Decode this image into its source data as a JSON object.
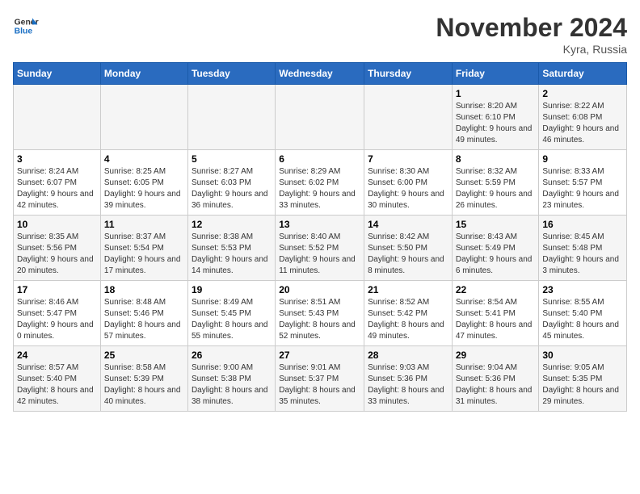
{
  "logo": {
    "text_general": "General",
    "text_blue": "Blue"
  },
  "header": {
    "month_year": "November 2024",
    "location": "Kyra, Russia"
  },
  "weekdays": [
    "Sunday",
    "Monday",
    "Tuesday",
    "Wednesday",
    "Thursday",
    "Friday",
    "Saturday"
  ],
  "weeks": [
    [
      {
        "day": "",
        "info": ""
      },
      {
        "day": "",
        "info": ""
      },
      {
        "day": "",
        "info": ""
      },
      {
        "day": "",
        "info": ""
      },
      {
        "day": "",
        "info": ""
      },
      {
        "day": "1",
        "info": "Sunrise: 8:20 AM\nSunset: 6:10 PM\nDaylight: 9 hours and 49 minutes."
      },
      {
        "day": "2",
        "info": "Sunrise: 8:22 AM\nSunset: 6:08 PM\nDaylight: 9 hours and 46 minutes."
      }
    ],
    [
      {
        "day": "3",
        "info": "Sunrise: 8:24 AM\nSunset: 6:07 PM\nDaylight: 9 hours and 42 minutes."
      },
      {
        "day": "4",
        "info": "Sunrise: 8:25 AM\nSunset: 6:05 PM\nDaylight: 9 hours and 39 minutes."
      },
      {
        "day": "5",
        "info": "Sunrise: 8:27 AM\nSunset: 6:03 PM\nDaylight: 9 hours and 36 minutes."
      },
      {
        "day": "6",
        "info": "Sunrise: 8:29 AM\nSunset: 6:02 PM\nDaylight: 9 hours and 33 minutes."
      },
      {
        "day": "7",
        "info": "Sunrise: 8:30 AM\nSunset: 6:00 PM\nDaylight: 9 hours and 30 minutes."
      },
      {
        "day": "8",
        "info": "Sunrise: 8:32 AM\nSunset: 5:59 PM\nDaylight: 9 hours and 26 minutes."
      },
      {
        "day": "9",
        "info": "Sunrise: 8:33 AM\nSunset: 5:57 PM\nDaylight: 9 hours and 23 minutes."
      }
    ],
    [
      {
        "day": "10",
        "info": "Sunrise: 8:35 AM\nSunset: 5:56 PM\nDaylight: 9 hours and 20 minutes."
      },
      {
        "day": "11",
        "info": "Sunrise: 8:37 AM\nSunset: 5:54 PM\nDaylight: 9 hours and 17 minutes."
      },
      {
        "day": "12",
        "info": "Sunrise: 8:38 AM\nSunset: 5:53 PM\nDaylight: 9 hours and 14 minutes."
      },
      {
        "day": "13",
        "info": "Sunrise: 8:40 AM\nSunset: 5:52 PM\nDaylight: 9 hours and 11 minutes."
      },
      {
        "day": "14",
        "info": "Sunrise: 8:42 AM\nSunset: 5:50 PM\nDaylight: 9 hours and 8 minutes."
      },
      {
        "day": "15",
        "info": "Sunrise: 8:43 AM\nSunset: 5:49 PM\nDaylight: 9 hours and 6 minutes."
      },
      {
        "day": "16",
        "info": "Sunrise: 8:45 AM\nSunset: 5:48 PM\nDaylight: 9 hours and 3 minutes."
      }
    ],
    [
      {
        "day": "17",
        "info": "Sunrise: 8:46 AM\nSunset: 5:47 PM\nDaylight: 9 hours and 0 minutes."
      },
      {
        "day": "18",
        "info": "Sunrise: 8:48 AM\nSunset: 5:46 PM\nDaylight: 8 hours and 57 minutes."
      },
      {
        "day": "19",
        "info": "Sunrise: 8:49 AM\nSunset: 5:45 PM\nDaylight: 8 hours and 55 minutes."
      },
      {
        "day": "20",
        "info": "Sunrise: 8:51 AM\nSunset: 5:43 PM\nDaylight: 8 hours and 52 minutes."
      },
      {
        "day": "21",
        "info": "Sunrise: 8:52 AM\nSunset: 5:42 PM\nDaylight: 8 hours and 49 minutes."
      },
      {
        "day": "22",
        "info": "Sunrise: 8:54 AM\nSunset: 5:41 PM\nDaylight: 8 hours and 47 minutes."
      },
      {
        "day": "23",
        "info": "Sunrise: 8:55 AM\nSunset: 5:40 PM\nDaylight: 8 hours and 45 minutes."
      }
    ],
    [
      {
        "day": "24",
        "info": "Sunrise: 8:57 AM\nSunset: 5:40 PM\nDaylight: 8 hours and 42 minutes."
      },
      {
        "day": "25",
        "info": "Sunrise: 8:58 AM\nSunset: 5:39 PM\nDaylight: 8 hours and 40 minutes."
      },
      {
        "day": "26",
        "info": "Sunrise: 9:00 AM\nSunset: 5:38 PM\nDaylight: 8 hours and 38 minutes."
      },
      {
        "day": "27",
        "info": "Sunrise: 9:01 AM\nSunset: 5:37 PM\nDaylight: 8 hours and 35 minutes."
      },
      {
        "day": "28",
        "info": "Sunrise: 9:03 AM\nSunset: 5:36 PM\nDaylight: 8 hours and 33 minutes."
      },
      {
        "day": "29",
        "info": "Sunrise: 9:04 AM\nSunset: 5:36 PM\nDaylight: 8 hours and 31 minutes."
      },
      {
        "day": "30",
        "info": "Sunrise: 9:05 AM\nSunset: 5:35 PM\nDaylight: 8 hours and 29 minutes."
      }
    ]
  ]
}
